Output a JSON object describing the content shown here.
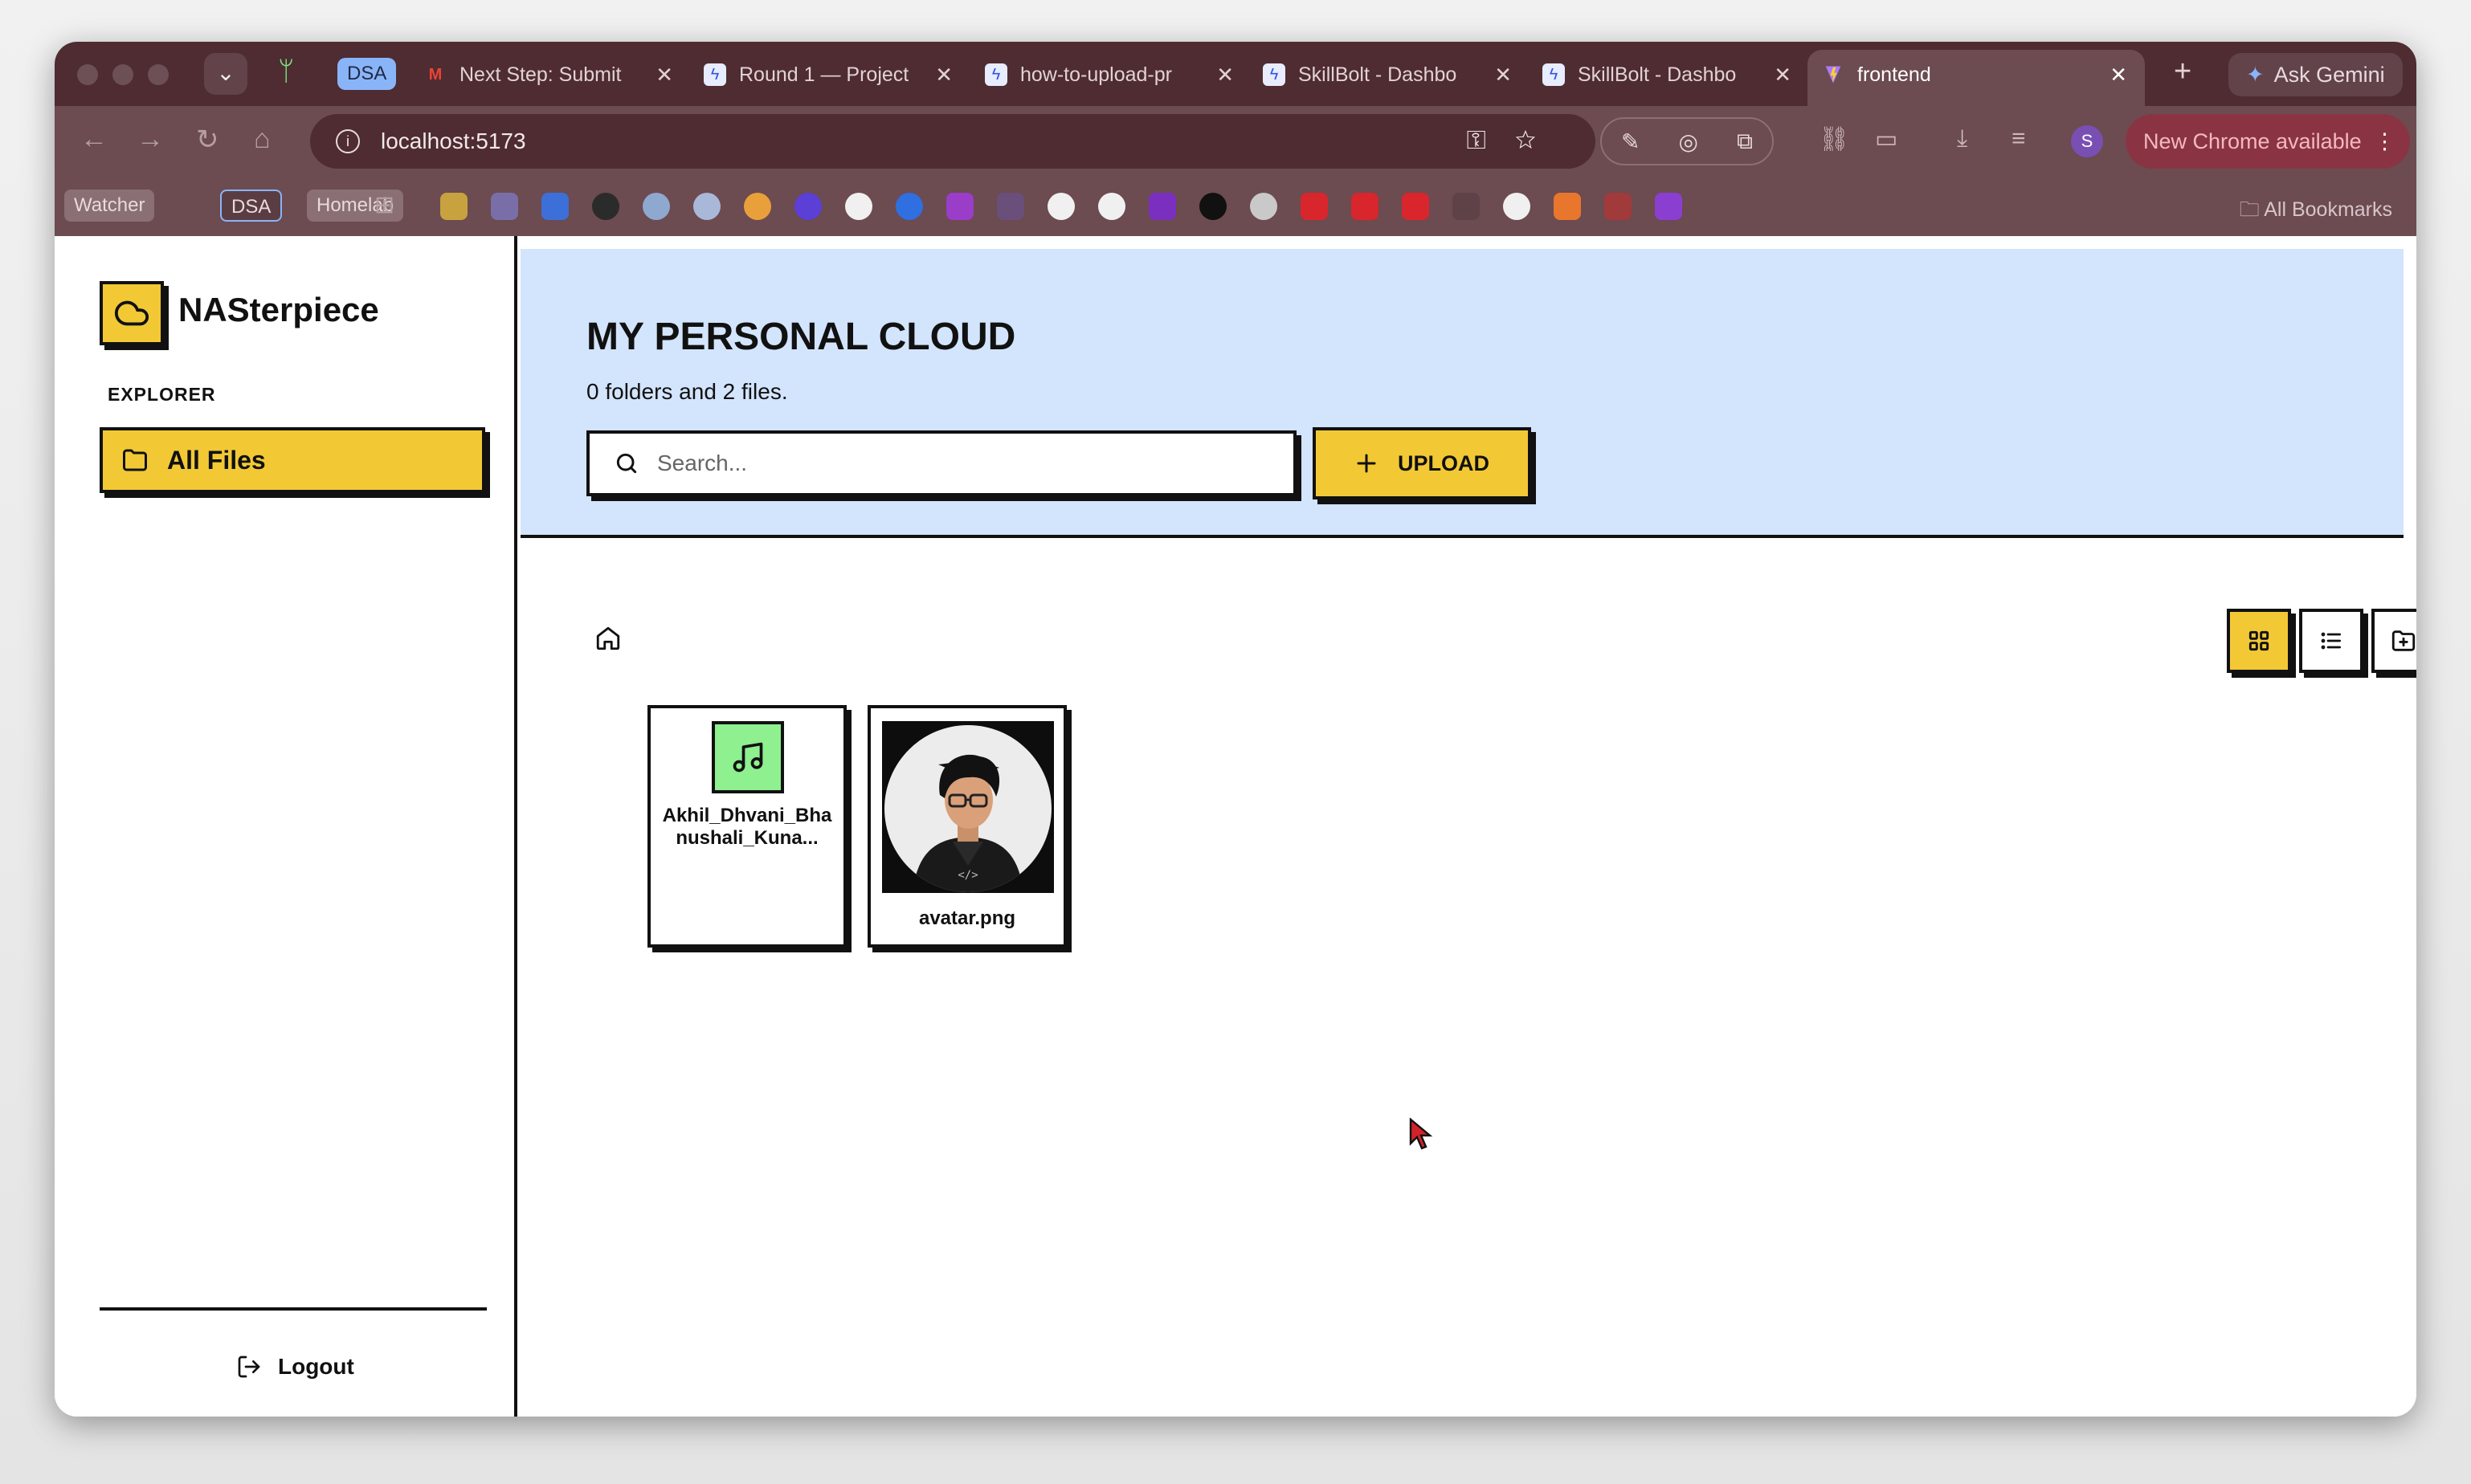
{
  "browser": {
    "tab_group_label": "DSA",
    "tabs": [
      {
        "title": "Next Step: Submit",
        "icon": "gmail-icon"
      },
      {
        "title": "Round 1 — Project",
        "icon": "bolt-icon"
      },
      {
        "title": "how-to-upload-pr",
        "icon": "bolt-icon"
      },
      {
        "title": "SkillBolt - Dashbo",
        "icon": "bolt-icon"
      },
      {
        "title": "SkillBolt - Dashbo",
        "icon": "bolt-icon"
      },
      {
        "title": "frontend",
        "icon": "vite-icon",
        "active": true
      }
    ],
    "gemini_label": "Ask Gemini",
    "url": "localhost:5173",
    "profile_initial": "S",
    "update_label": "New Chrome available",
    "bookmarks": {
      "chips": [
        "Watcher",
        "DSA",
        "Homelab"
      ],
      "all_label": "All Bookmarks"
    }
  },
  "app": {
    "brand": "NASterpiece",
    "explorer_label": "EXPLORER",
    "nav_all_files": "All Files",
    "logout_label": "Logout",
    "hero_title": "MY PERSONAL CLOUD",
    "hero_subtitle": "0 folders and 2 files.",
    "search_placeholder": "Search...",
    "upload_label": "UPLOAD",
    "files": [
      {
        "name": "Akhil_Dhvani_Bhanushali_Kuna...",
        "type": "audio",
        "icon": "music-note-icon"
      },
      {
        "name": "avatar.png",
        "type": "image",
        "preview": "avatar-illustration"
      }
    ]
  },
  "colors": {
    "accent_yellow": "#f2c935",
    "hero_blue": "#d3e4fd",
    "audio_green": "#8ef08e",
    "chrome_dark": "#4e2c32"
  }
}
